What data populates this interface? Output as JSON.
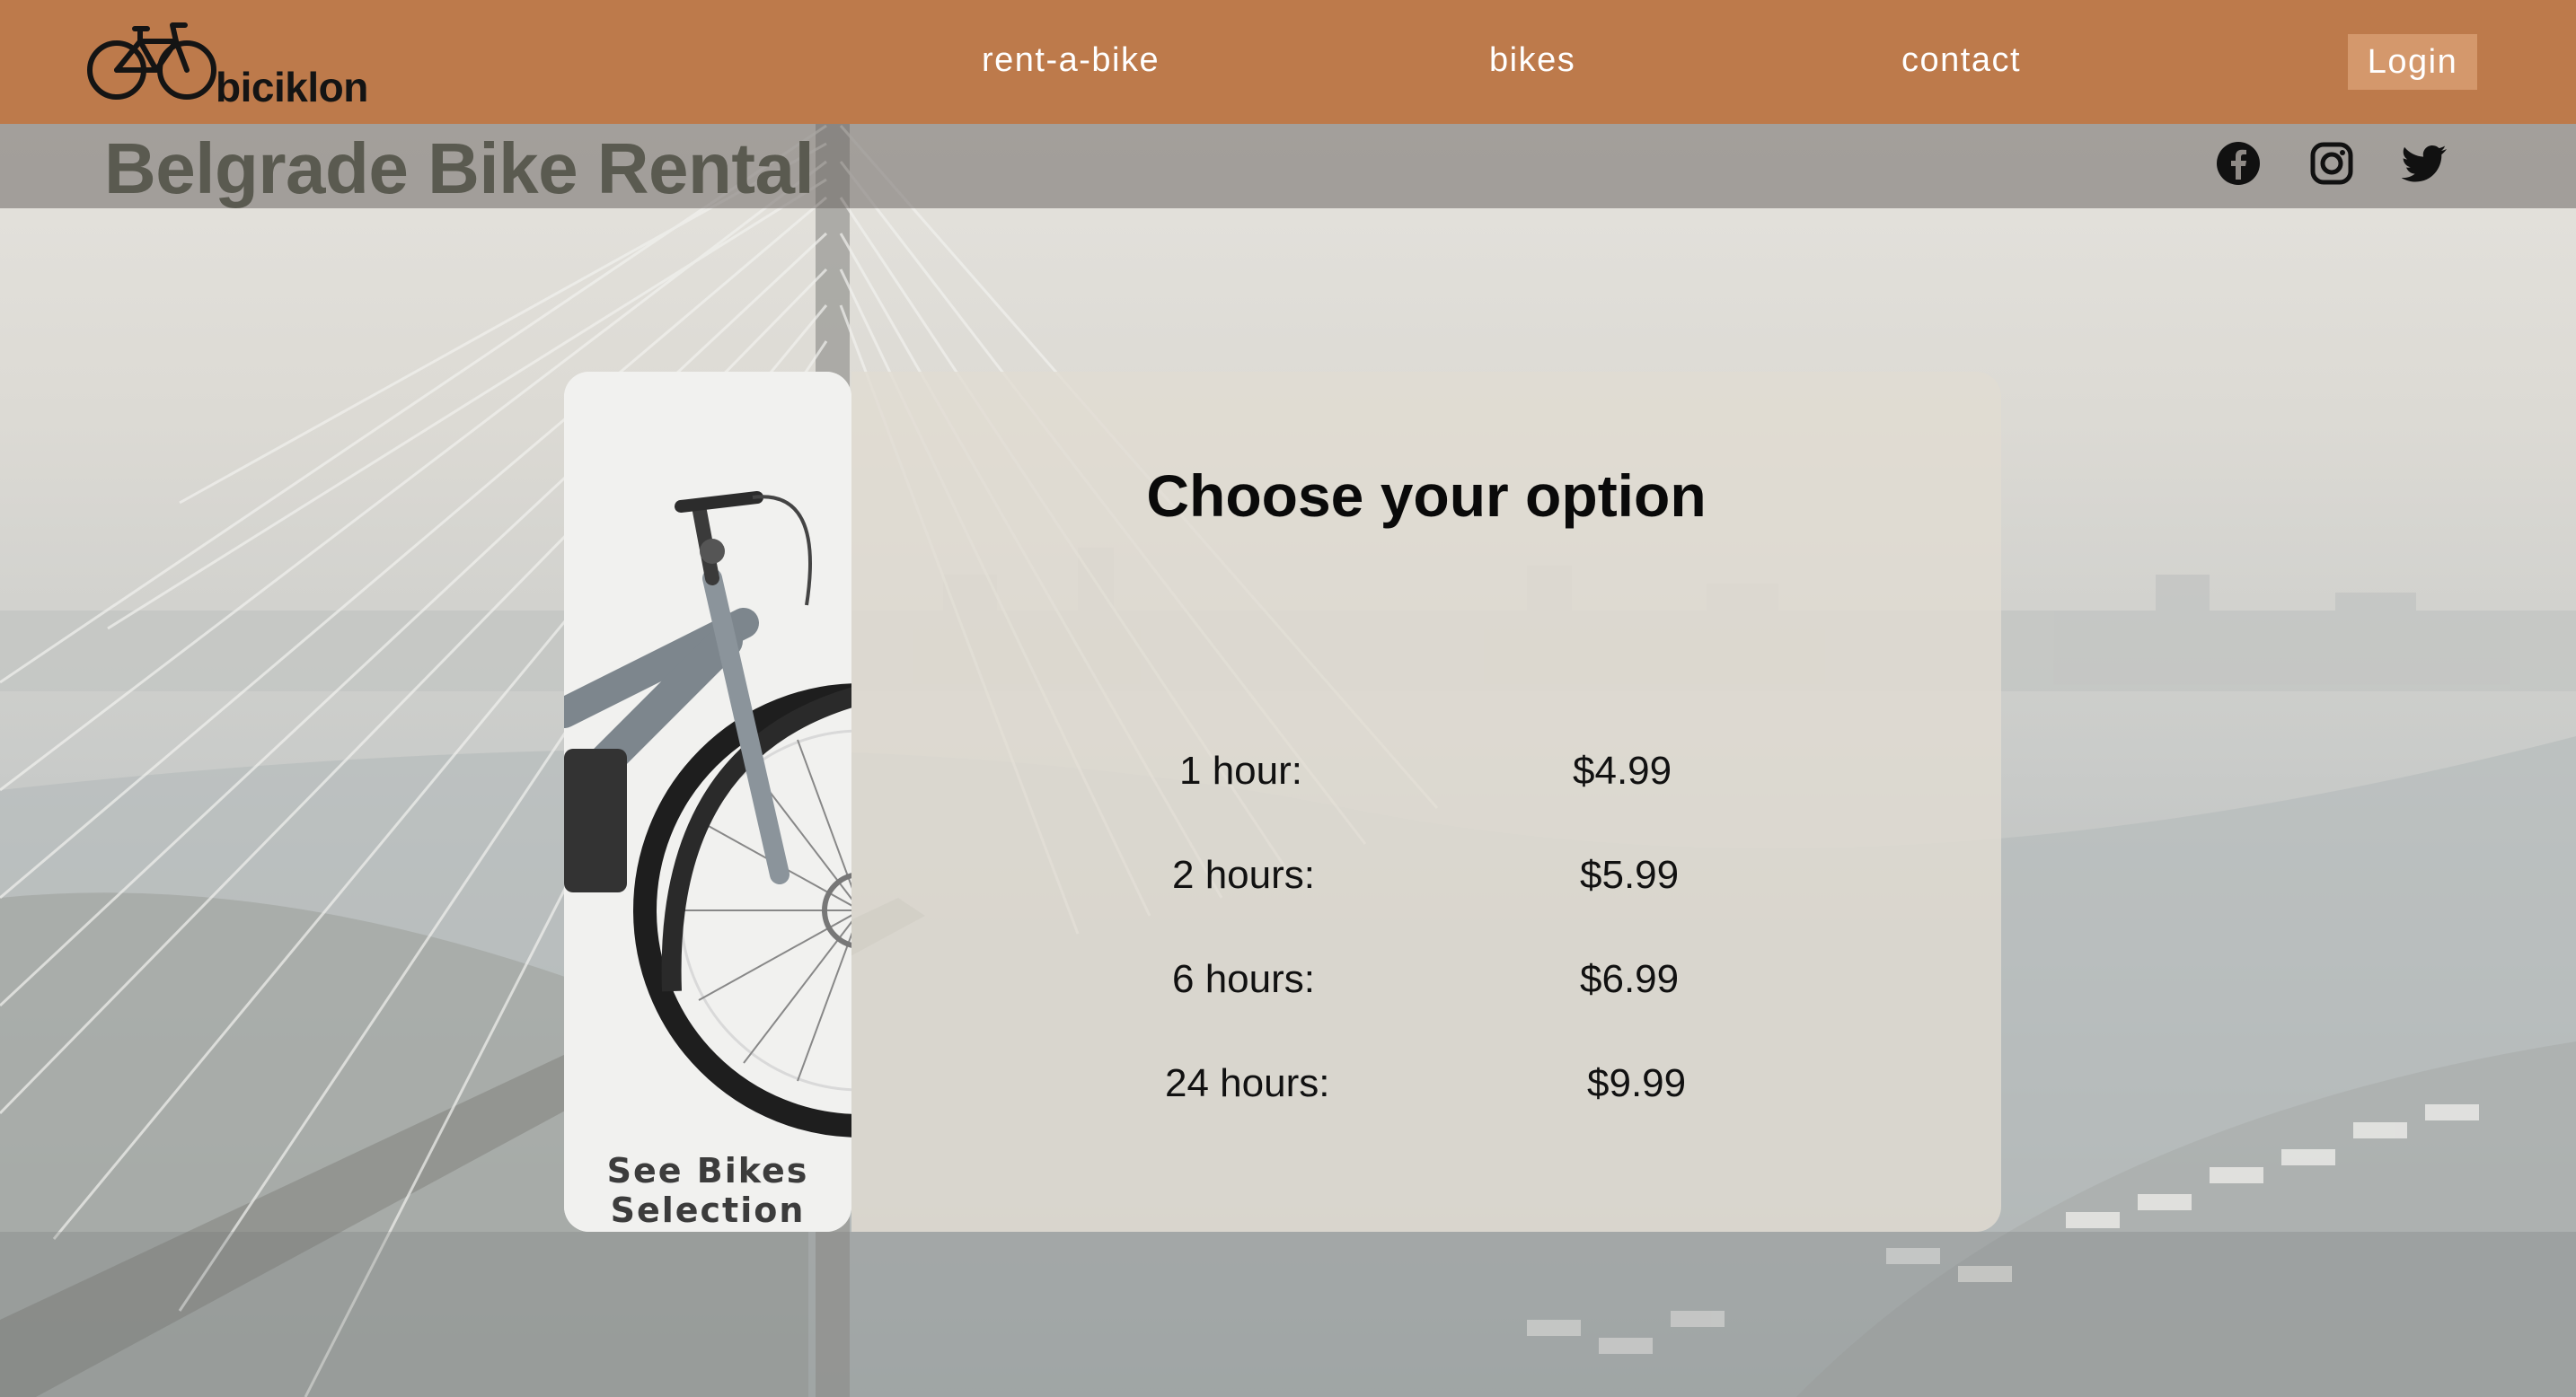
{
  "header": {
    "brand": "biciklon",
    "nav": [
      {
        "label": "rent-a-bike"
      },
      {
        "label": "bikes"
      },
      {
        "label": "contact"
      }
    ],
    "login_label": "Login",
    "colors": {
      "bar": "#bd7a4b",
      "login_bg": "#d4986c"
    }
  },
  "hero": {
    "title": "Belgrade Bike Rental",
    "social": [
      "facebook-icon",
      "instagram-icon",
      "twitter-icon"
    ]
  },
  "bike_card": {
    "caption_line1": "See Bikes",
    "caption_line2": "Selection"
  },
  "options": {
    "title": "Choose your option",
    "prices": [
      {
        "label": "1 hour:",
        "value": "$4.99"
      },
      {
        "label": "2 hours:",
        "value": "$5.99"
      },
      {
        "label": "6 hours:",
        "value": "$6.99"
      },
      {
        "label": "24 hours:",
        "value": "$9.99"
      }
    ]
  }
}
